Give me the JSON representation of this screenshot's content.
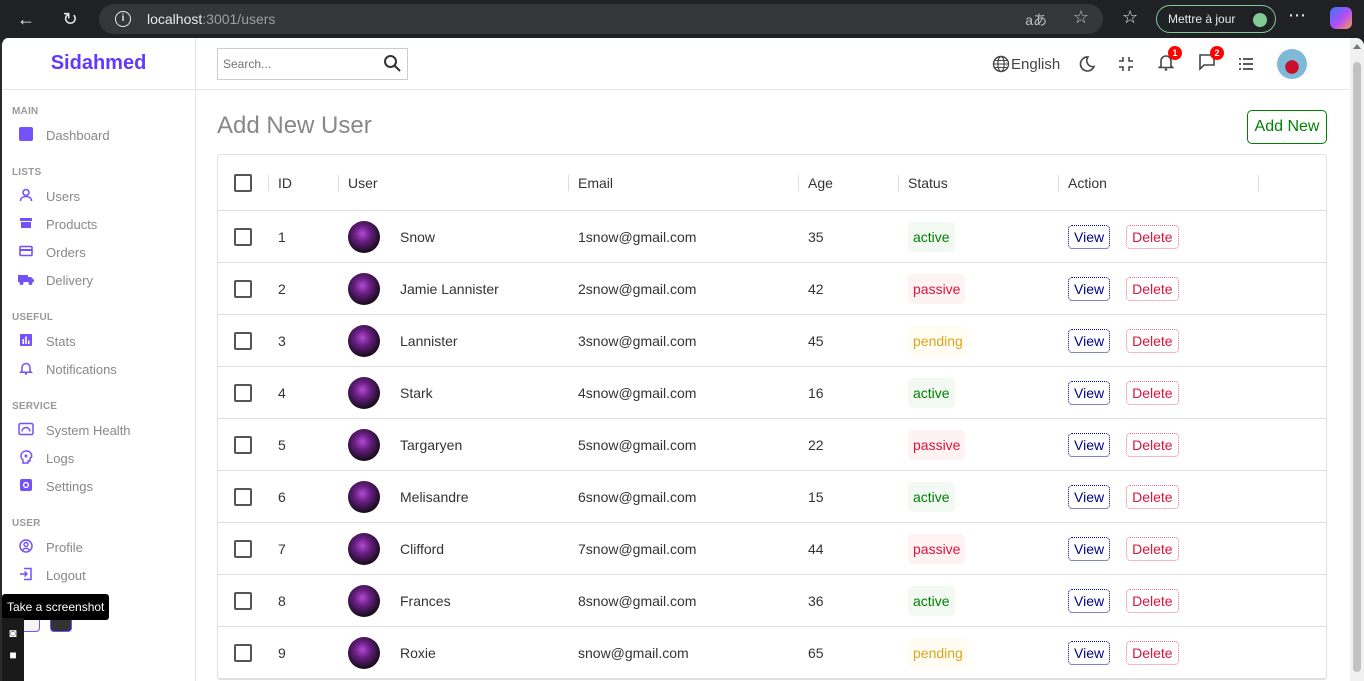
{
  "browser": {
    "url_host": "localhost",
    "url_rest": ":3001/users",
    "translate_label": "aあ",
    "update_label": "Mettre à jour"
  },
  "sidebar": {
    "logo": "Sidahmed",
    "sections": [
      {
        "title": "MAIN",
        "items": [
          {
            "label": "Dashboard",
            "icon": "dashboard-icon"
          }
        ]
      },
      {
        "title": "LISTS",
        "items": [
          {
            "label": "Users",
            "icon": "person-icon"
          },
          {
            "label": "Products",
            "icon": "store-icon"
          },
          {
            "label": "Orders",
            "icon": "credit-card-icon"
          },
          {
            "label": "Delivery",
            "icon": "truck-icon"
          }
        ]
      },
      {
        "title": "USEFUL",
        "items": [
          {
            "label": "Stats",
            "icon": "chart-icon"
          },
          {
            "label": "Notifications",
            "icon": "bell-icon"
          }
        ]
      },
      {
        "title": "SERVICE",
        "items": [
          {
            "label": "System Health",
            "icon": "health-icon"
          },
          {
            "label": "Logs",
            "icon": "psychology-icon"
          },
          {
            "label": "Settings",
            "icon": "gear-icon"
          }
        ]
      },
      {
        "title": "USER",
        "items": [
          {
            "label": "Profile",
            "icon": "account-circle-icon"
          },
          {
            "label": "Logout",
            "icon": "logout-icon"
          }
        ]
      }
    ],
    "tooltip": "Take a screenshot"
  },
  "topbar": {
    "search_placeholder": "Search...",
    "language": "English",
    "notifications_count": "1",
    "messages_count": "2"
  },
  "page": {
    "title": "Add New User",
    "add_new_label": "Add New"
  },
  "table": {
    "columns": [
      "ID",
      "User",
      "Email",
      "Age",
      "Status",
      "Action"
    ],
    "view_label": "View",
    "delete_label": "Delete",
    "rows": [
      {
        "id": "1",
        "user": "Snow",
        "email": "1snow@gmail.com",
        "age": "35",
        "status": "active"
      },
      {
        "id": "2",
        "user": "Jamie Lannister",
        "email": "2snow@gmail.com",
        "age": "42",
        "status": "passive"
      },
      {
        "id": "3",
        "user": "Lannister",
        "email": "3snow@gmail.com",
        "age": "45",
        "status": "pending"
      },
      {
        "id": "4",
        "user": "Stark",
        "email": "4snow@gmail.com",
        "age": "16",
        "status": "active"
      },
      {
        "id": "5",
        "user": "Targaryen",
        "email": "5snow@gmail.com",
        "age": "22",
        "status": "passive"
      },
      {
        "id": "6",
        "user": "Melisandre",
        "email": "6snow@gmail.com",
        "age": "15",
        "status": "active"
      },
      {
        "id": "7",
        "user": "Clifford",
        "email": "7snow@gmail.com",
        "age": "44",
        "status": "passive"
      },
      {
        "id": "8",
        "user": "Frances",
        "email": "8snow@gmail.com",
        "age": "36",
        "status": "active"
      },
      {
        "id": "9",
        "user": "Roxie",
        "email": "snow@gmail.com",
        "age": "65",
        "status": "pending"
      }
    ]
  },
  "colors": {
    "brand": "#6439ff",
    "sidebar_icon": "#7451f8",
    "active": "#008000",
    "passive": "#dc143c",
    "pending": "#daa520"
  }
}
